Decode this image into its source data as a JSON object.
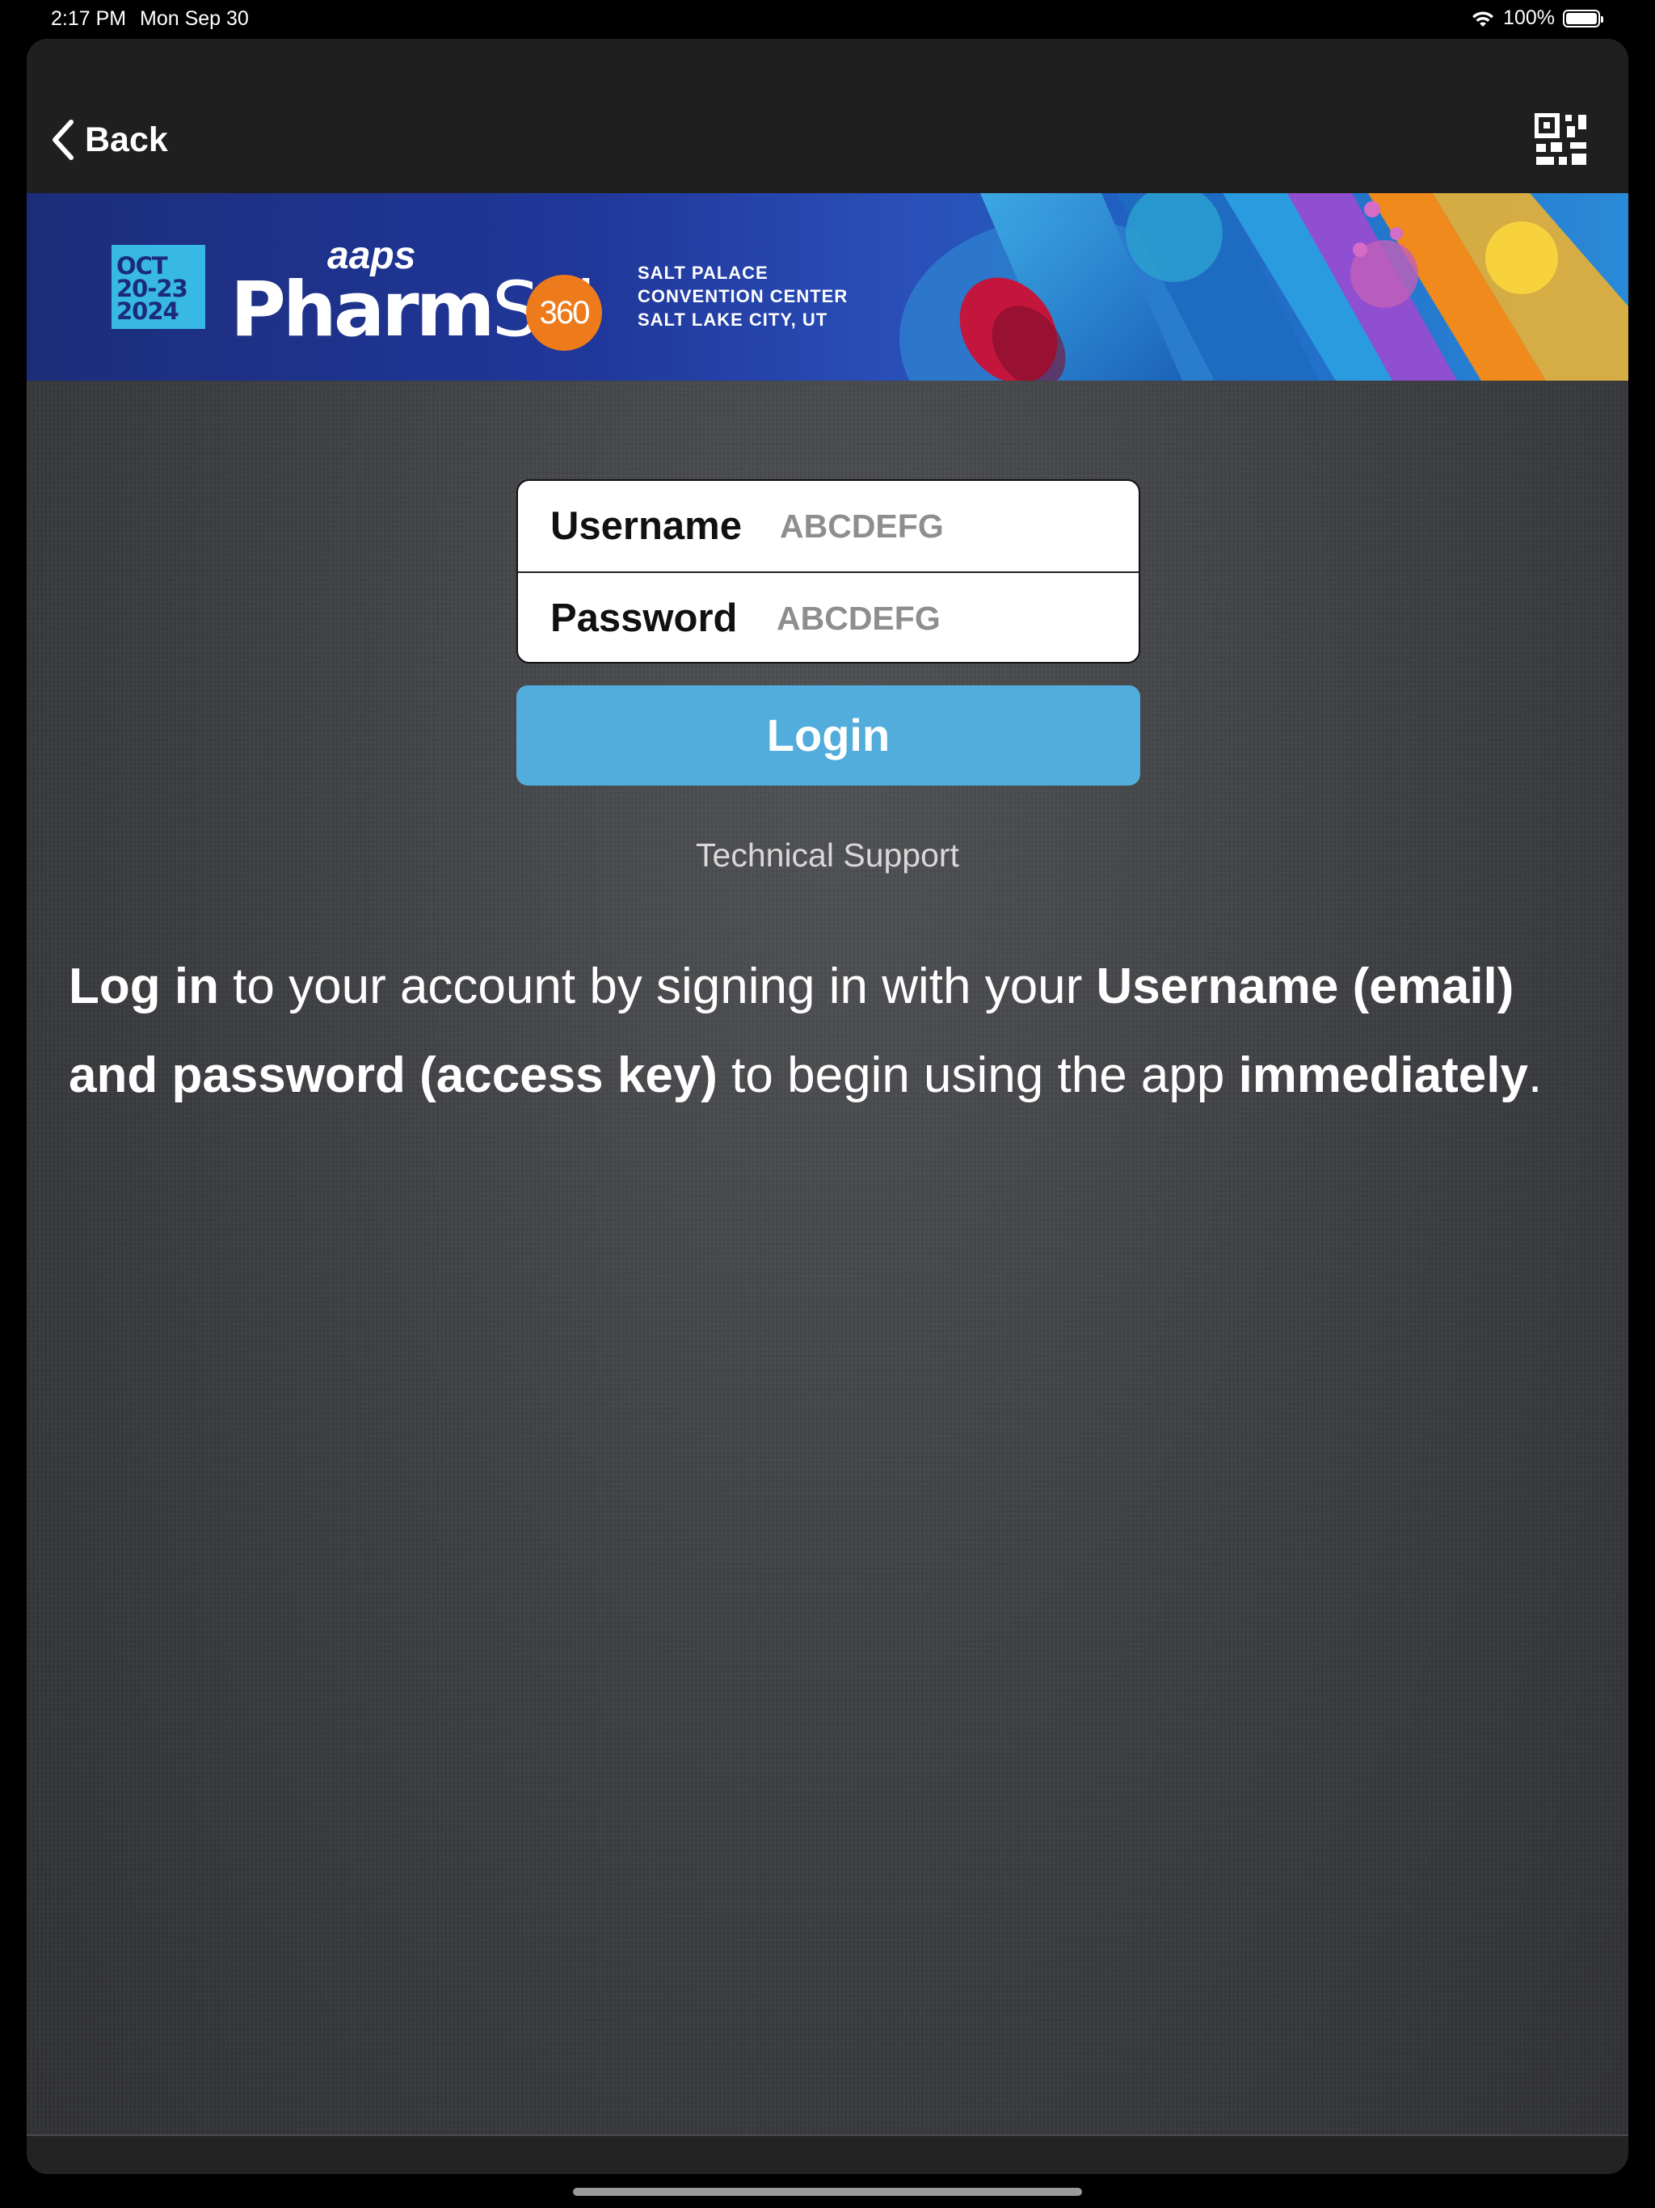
{
  "status_bar": {
    "time": "2:17 PM",
    "date": "Mon Sep 30",
    "battery_text": "100%",
    "battery_level": 1.0
  },
  "nav": {
    "back_label": "Back",
    "qr_icon": "qr-code-scan-icon"
  },
  "banner": {
    "date_month": "OCT",
    "date_days": "20-23",
    "date_year": "2024",
    "brand_org": "aaps",
    "brand_name_bold": "Pharm",
    "brand_name_light": "Sci",
    "brand_number": "360",
    "venue_line1": "SALT PALACE",
    "venue_line2": "CONVENTION CENTER",
    "venue_line3": "SALT LAKE CITY, UT"
  },
  "form": {
    "username_label": "Username",
    "username_placeholder": "ABCDEFG",
    "password_label": "Password",
    "password_placeholder": "ABCDEFG",
    "login_label": "Login",
    "support_label": "Technical Support"
  },
  "info": {
    "part1_bold": "Log in",
    "part2": " to your account by signing in with your ",
    "part3_bold": "Username (email) and password (access key)",
    "part4": " to begin using the app ",
    "part5_bold": "immediately",
    "part6": "."
  },
  "colors": {
    "accent": "#52acdc",
    "navbar": "#1f1f20",
    "banner_blue": "#20379a",
    "brand_orange": "#ee7b1b"
  }
}
